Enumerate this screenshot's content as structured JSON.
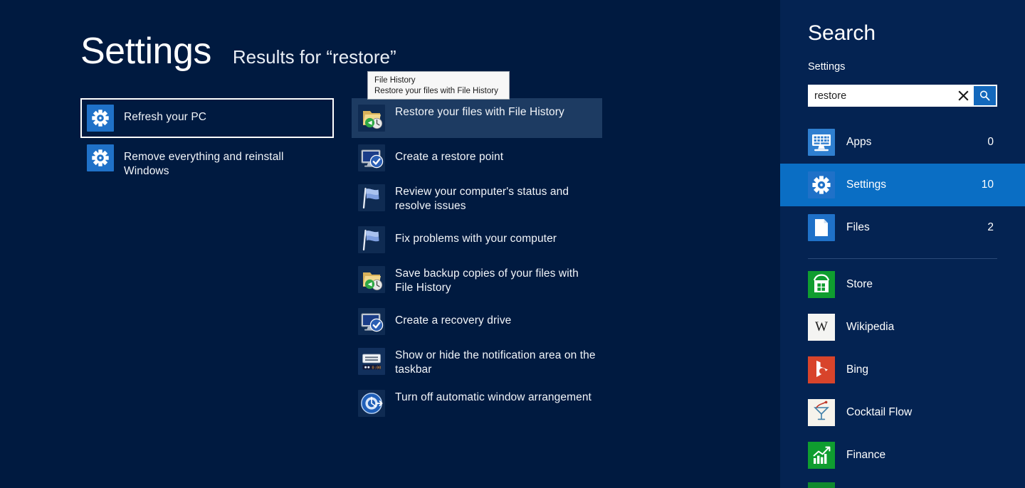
{
  "header": {
    "title": "Settings",
    "results_label": "Results for “restore”"
  },
  "tooltip": {
    "line1": "File History",
    "line2": "Restore your files with File History"
  },
  "left_results": [
    {
      "label": "Refresh your PC",
      "icon": "gear-icon",
      "focused": true
    },
    {
      "label": "Remove everything and reinstall Windows",
      "icon": "gear-icon",
      "focused": false
    }
  ],
  "mid_results": [
    {
      "label": "Restore your files with File History",
      "icon": "file-history-icon",
      "selected": true
    },
    {
      "label": "Create a restore point",
      "icon": "system-restore-icon",
      "selected": false
    },
    {
      "label": "Review your computer's status and resolve issues",
      "icon": "action-center-flag-icon",
      "selected": false
    },
    {
      "label": "Fix problems with your computer",
      "icon": "action-center-flag-icon",
      "selected": false
    },
    {
      "label": "Save backup copies of your files with File History",
      "icon": "file-history-icon",
      "selected": false
    },
    {
      "label": "Create a recovery drive",
      "icon": "system-restore-icon",
      "selected": false
    },
    {
      "label": "Show or hide the notification area on the taskbar",
      "icon": "taskbar-notification-icon",
      "selected": false
    },
    {
      "label": "Turn off automatic window arrangement",
      "icon": "window-arrangement-icon",
      "selected": false
    }
  ],
  "sidebar": {
    "title": "Search",
    "scope_label": "Settings",
    "search": {
      "value": "restore",
      "placeholder": "Search",
      "clear_icon": "close-icon",
      "submit_icon": "search-icon"
    },
    "categories": [
      {
        "label": "Apps",
        "count": "0",
        "icon": "apps-icon",
        "active": false
      },
      {
        "label": "Settings",
        "count": "10",
        "icon": "settings-gear-icon",
        "active": true
      },
      {
        "label": "Files",
        "count": "2",
        "icon": "files-document-icon",
        "active": false
      }
    ],
    "apps": [
      {
        "label": "Store",
        "icon": "store-icon"
      },
      {
        "label": "Wikipedia",
        "icon": "wikipedia-icon"
      },
      {
        "label": "Bing",
        "icon": "bing-icon"
      },
      {
        "label": "Cocktail Flow",
        "icon": "cocktail-flow-icon"
      },
      {
        "label": "Finance",
        "icon": "finance-icon"
      }
    ]
  },
  "colors": {
    "background": "#001a40",
    "sidebar_background": "#042352",
    "accent_selected": "#0a6ec4",
    "row_selected": "#1d3b62",
    "tile_blue": "#1f71c8"
  }
}
